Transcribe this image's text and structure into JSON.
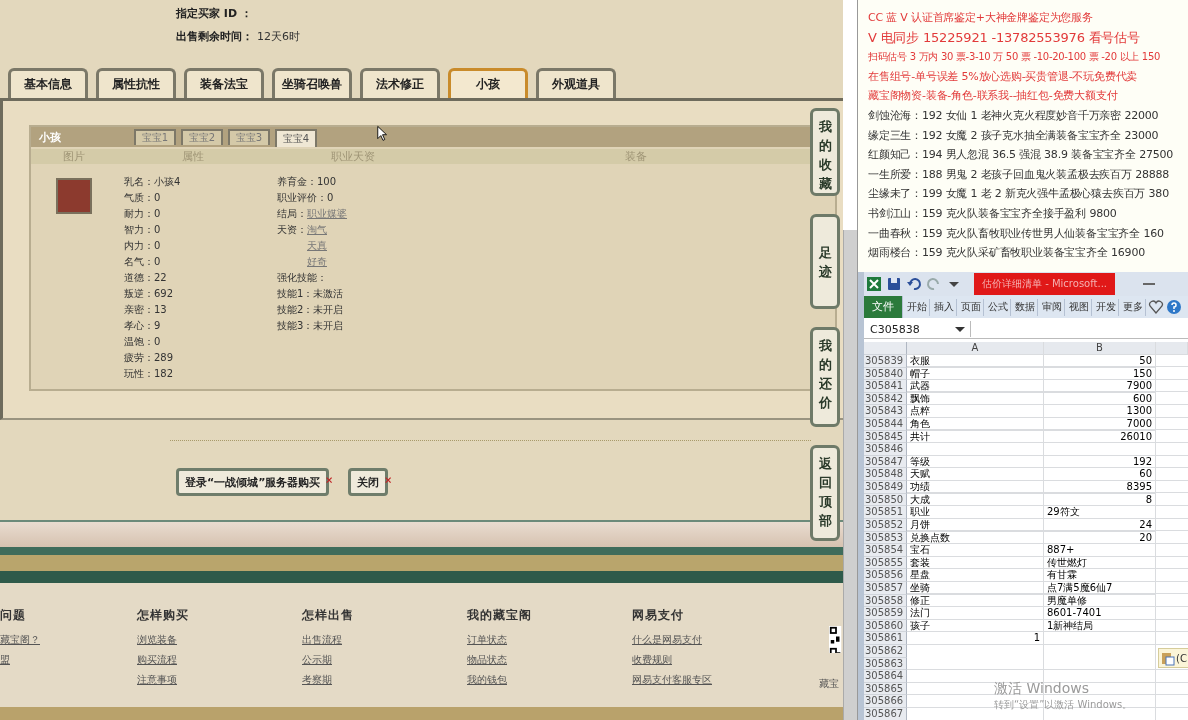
{
  "buyer_info": {
    "buyer_label": "指定买家 ID ：",
    "remaining_label": "出售剩余时间：",
    "remaining_value": "12天6时"
  },
  "tabs": [
    {
      "label": "基本信息",
      "selected": false
    },
    {
      "label": "属性抗性",
      "selected": false
    },
    {
      "label": "装备法宝",
      "selected": false
    },
    {
      "label": "坐骑召唤兽",
      "selected": false
    },
    {
      "label": "法术修正",
      "selected": false
    },
    {
      "label": "小孩",
      "selected": true
    },
    {
      "label": "外观道具",
      "selected": false
    }
  ],
  "child_panel": {
    "title": "小孩",
    "baby_tabs": [
      {
        "label": "宝宝1",
        "selected": false
      },
      {
        "label": "宝宝2",
        "selected": false
      },
      {
        "label": "宝宝3",
        "selected": false
      },
      {
        "label": "宝宝4",
        "selected": true
      }
    ],
    "columns": [
      "图片",
      "属性",
      "职业天资",
      "装备"
    ],
    "attributes": [
      "乳名：小孩4",
      "气质：0",
      "耐力：0",
      "智力：0",
      "内力：0",
      "名气：0",
      "道德：22",
      "叛逆：692",
      "亲密：13",
      "孝心：9",
      "温饱：0",
      "疲劳：289",
      "玩性：182"
    ],
    "career": [
      {
        "label": "养育金：100"
      },
      {
        "label": "职业评价：0"
      },
      {
        "label": "结局：",
        "links": [
          "职业媒婆"
        ]
      },
      {
        "label": "天资：",
        "links": [
          "淘气",
          "天真",
          "好奇"
        ]
      },
      {
        "label": "强化技能："
      },
      {
        "label": "技能1：未激活"
      },
      {
        "label": "技能2：未开启"
      },
      {
        "label": "技能3：未开启"
      }
    ]
  },
  "side_buttons": [
    "我的收藏",
    "足迹",
    "我的还价",
    "返回顶部"
  ],
  "actions": [
    "登录“一战倾城”服务器购买",
    "关闭"
  ],
  "footer": {
    "columns": [
      {
        "title": "问题",
        "links": [
          "藏宝阁？",
          "盟"
        ]
      },
      {
        "title": "怎样购买",
        "links": [
          "浏览装备",
          "购买流程",
          "注意事项"
        ]
      },
      {
        "title": "怎样出售",
        "links": [
          "出售流程",
          "公示期",
          "考察期"
        ]
      },
      {
        "title": "我的藏宝阁",
        "links": [
          "订单状态",
          "物品状态",
          "我的钱包"
        ]
      },
      {
        "title": "网易支付",
        "links": [
          "什么是网易支付",
          "收费规则",
          "网易支付客服专区"
        ]
      }
    ],
    "side_text": "藏宝"
  },
  "doc": {
    "lines": [
      {
        "text": "CC 蓝 V 认证首席鉴定+大神金牌鉴定为您服务",
        "color": "#e23a3a"
      },
      {
        "text": "V 电同步 15225921    -13782553976 看号估号",
        "color": "#e23a3a"
      },
      {
        "text": "扫码估号 3 万内 30 票-3-10 万 50 票 -10-20-100 票 -20 以上 150",
        "color": "#e23a3a"
      },
      {
        "text": "在售组号-单号误差 5%放心选购-买贵管退-不玩免费代卖",
        "color": "#e23a3a"
      },
      {
        "text": "藏宝阁物资-装备-角色-联系我--抽红包-免费大额支付",
        "color": "#e23a3a"
      },
      {
        "text": "剑蚀沧海：192 女仙 1 老神火克火程度妙音千万亲密 22000",
        "color": "#333333"
      },
      {
        "text": "缘定三生：192 女魔 2 孩子克水抽全满装备宝宝齐全 23000",
        "color": "#333333"
      },
      {
        "text": "红颜知己：194 男人忽混 36.5 强混 38.9 装备宝宝齐全 27500",
        "color": "#333333"
      },
      {
        "text": "一生所爱：188 男鬼 2 老孩子回血鬼火装孟极去疾百万 28888",
        "color": "#333333"
      },
      {
        "text": "尘缘未了：199 女魔 1 老 2 新克火强牛孟极心猿去疾百万 380",
        "color": "#333333"
      },
      {
        "text": "书剑江山：159 克火队装备宝宝齐全接手盈利 9800",
        "color": "#333333"
      },
      {
        "text": "一曲春秋：159 克火队畜牧职业传世男人仙装备宝宝齐全 160",
        "color": "#333333"
      },
      {
        "text": "烟雨楼台：159 克火队采矿畜牧职业装备宝宝齐全 16900",
        "color": "#333333"
      }
    ]
  },
  "excel": {
    "title": "估价详细清单 - Microsoft...",
    "ribbon_tabs": [
      {
        "label": "文件",
        "selected": true
      },
      {
        "label": "开始",
        "selected": false
      },
      {
        "label": "插入",
        "selected": false
      },
      {
        "label": "页面",
        "selected": false
      },
      {
        "label": "公式",
        "selected": false
      },
      {
        "label": "数据",
        "selected": false
      },
      {
        "label": "审阅",
        "selected": false
      },
      {
        "label": "视图",
        "selected": false
      },
      {
        "label": "开发",
        "selected": false
      },
      {
        "label": "更多",
        "selected": false
      }
    ],
    "name_box": "C305838",
    "columns": [
      "A",
      "B"
    ],
    "rows": [
      {
        "num": "305839",
        "cells": [
          {
            "text": "衣服",
            "kind": "text"
          },
          {
            "text": "50",
            "kind": "number"
          }
        ]
      },
      {
        "num": "305840",
        "cells": [
          {
            "text": "帽子",
            "kind": "text"
          },
          {
            "text": "150",
            "kind": "number"
          }
        ]
      },
      {
        "num": "305841",
        "cells": [
          {
            "text": "武器",
            "kind": "text"
          },
          {
            "text": "7900",
            "kind": "number"
          }
        ]
      },
      {
        "num": "305842",
        "cells": [
          {
            "text": "飘饰",
            "kind": "text"
          },
          {
            "text": "600",
            "kind": "number"
          }
        ]
      },
      {
        "num": "305843",
        "cells": [
          {
            "text": "点粹",
            "kind": "text"
          },
          {
            "text": "1300",
            "kind": "number"
          }
        ]
      },
      {
        "num": "305844",
        "cells": [
          {
            "text": "角色",
            "kind": "text"
          },
          {
            "text": "7000",
            "kind": "number"
          }
        ]
      },
      {
        "num": "305845",
        "cells": [
          {
            "text": "共计",
            "kind": "text"
          },
          {
            "text": "26010",
            "kind": "number"
          }
        ]
      },
      {
        "num": "305846"
      },
      {
        "num": "305847",
        "cells": [
          {
            "text": "等级",
            "kind": "text"
          },
          {
            "text": "192",
            "kind": "number"
          }
        ]
      },
      {
        "num": "305848",
        "cells": [
          {
            "text": "天赋",
            "kind": "text"
          },
          {
            "text": "60",
            "kind": "number"
          }
        ]
      },
      {
        "num": "305849",
        "cells": [
          {
            "text": "功绩",
            "kind": "text"
          },
          {
            "text": "8395",
            "kind": "number"
          }
        ]
      },
      {
        "num": "305850",
        "cells": [
          {
            "text": "大成",
            "kind": "text"
          },
          {
            "text": "8",
            "kind": "number"
          }
        ]
      },
      {
        "num": "305851",
        "cells": [
          {
            "text": "职业",
            "kind": "text"
          },
          {
            "text": "29符文",
            "kind": "text"
          }
        ]
      },
      {
        "num": "305852",
        "cells": [
          {
            "text": "月饼",
            "kind": "text"
          },
          {
            "text": "24",
            "kind": "number"
          }
        ]
      },
      {
        "num": "305853",
        "cells": [
          {
            "text": "兑换点数",
            "kind": "text"
          },
          {
            "text": "20",
            "kind": "number"
          }
        ]
      },
      {
        "num": "305854",
        "cells": [
          {
            "text": "宝石",
            "kind": "text"
          },
          {
            "text": "887+",
            "kind": "text"
          }
        ]
      },
      {
        "num": "305855",
        "cells": [
          {
            "text": "套装",
            "kind": "text"
          },
          {
            "text": "传世燃灯",
            "kind": "text"
          }
        ]
      },
      {
        "num": "305856",
        "cells": [
          {
            "text": "星盘",
            "kind": "text"
          },
          {
            "text": "有甘霖",
            "kind": "text"
          }
        ]
      },
      {
        "num": "305857",
        "cells": [
          {
            "text": "坐骑",
            "kind": "text"
          },
          {
            "text": "点7满5魔6仙7",
            "kind": "text"
          }
        ]
      },
      {
        "num": "305858",
        "cells": [
          {
            "text": "修正",
            "kind": "text"
          },
          {
            "text": "男魔单修",
            "kind": "text"
          }
        ]
      },
      {
        "num": "305859",
        "cells": [
          {
            "text": "法门",
            "kind": "text"
          },
          {
            "text": "8601-7401",
            "kind": "text"
          }
        ]
      },
      {
        "num": "305860",
        "cells": [
          {
            "text": "孩子",
            "kind": "text"
          },
          {
            "text": "1新神结局",
            "kind": "text"
          }
        ]
      },
      {
        "num": "305861",
        "cells": [
          {
            "text": "1",
            "kind": "number"
          }
        ]
      },
      {
        "num": "305862"
      },
      {
        "num": "305863"
      },
      {
        "num": "305864"
      },
      {
        "num": "305865"
      },
      {
        "num": "305866"
      },
      {
        "num": "305867"
      }
    ],
    "paste_options": "(C"
  },
  "os_notice": {
    "title": "激活 Windows",
    "hint": "转到“设置”以激活 Windows。"
  }
}
